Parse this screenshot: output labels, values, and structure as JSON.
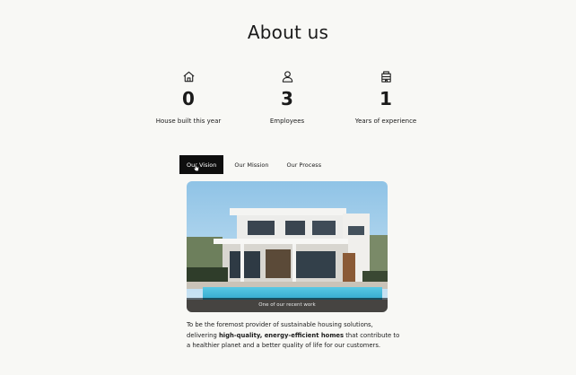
{
  "page": {
    "title": "About us"
  },
  "stats": [
    {
      "icon": "house-icon",
      "value": "0",
      "label": "House built this year"
    },
    {
      "icon": "person-icon",
      "value": "3",
      "label": "Employees"
    },
    {
      "icon": "building-icon",
      "value": "1",
      "label": "Years of experience"
    }
  ],
  "tabs": [
    {
      "label": "Our Vision",
      "active": true
    },
    {
      "label": "Our Mission",
      "active": false
    },
    {
      "label": "Our Process",
      "active": false
    }
  ],
  "content": {
    "image_caption": "One of our recent work",
    "desc_part1": "To be the foremost provider of sustainable housing solutions, delivering ",
    "desc_bold": "high-quality, energy-efficient homes",
    "desc_part2": " that contribute to a healthier planet and a better quality of life for our customers."
  },
  "colors": {
    "background": "#f8f8f5",
    "tab_active_bg": "#0e0e0e",
    "pool": "#3fb6d6"
  }
}
